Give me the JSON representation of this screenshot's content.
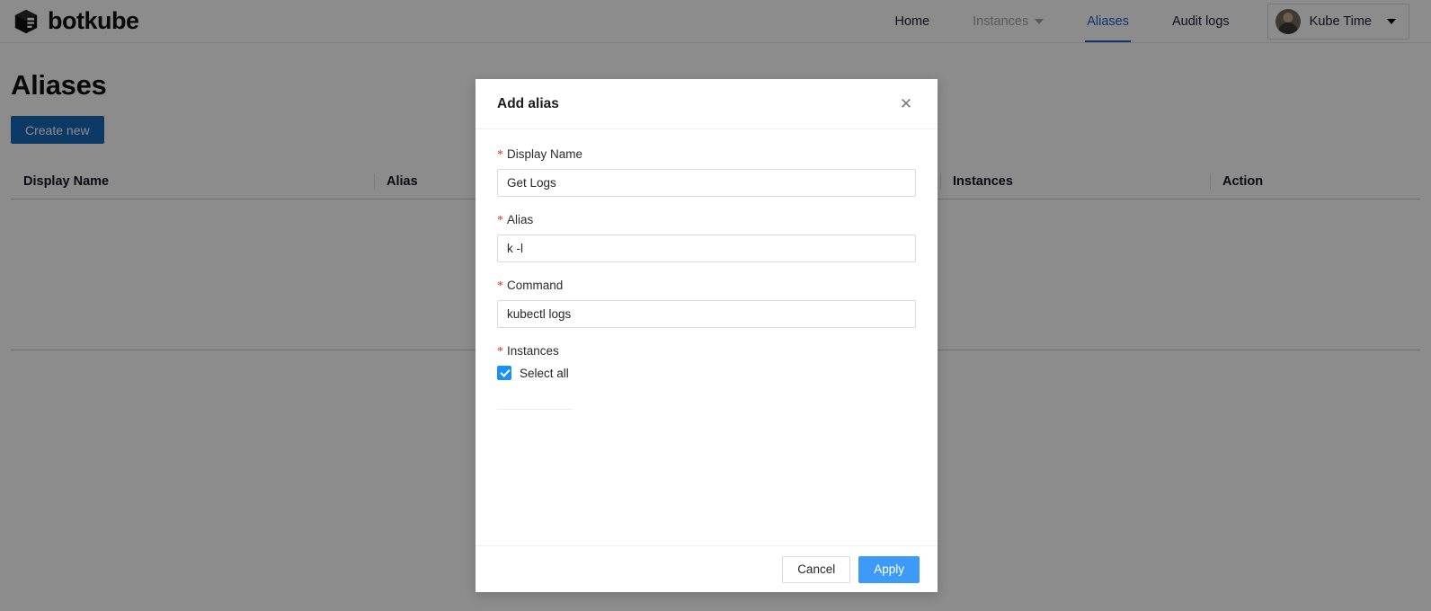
{
  "brand": {
    "name": "botkube",
    "logo_icon": "cube-icon"
  },
  "nav": {
    "items": [
      {
        "label": "Home",
        "state": "default",
        "icon": null
      },
      {
        "label": "Instances",
        "state": "muted",
        "icon": "chevron-down-icon"
      },
      {
        "label": "Aliases",
        "state": "active",
        "icon": null
      },
      {
        "label": "Audit logs",
        "state": "default",
        "icon": null
      }
    ],
    "user": {
      "name": "Kube Time",
      "avatar_icon": "avatar",
      "caret_icon": "chevron-down-icon"
    },
    "active_color": "#1c5fd0"
  },
  "page": {
    "title": "Aliases",
    "create_button": "Create new",
    "create_button_color": "#1669bb"
  },
  "table": {
    "columns": [
      "Display Name",
      "Alias",
      "Instances",
      "Action"
    ],
    "rows": []
  },
  "modal": {
    "title": "Add alias",
    "close_icon": "close-icon",
    "required_mark": "*",
    "fields": [
      {
        "label": "Display Name",
        "value": "Get Logs",
        "placeholder": ""
      },
      {
        "label": "Alias",
        "value": "k -l",
        "placeholder": ""
      },
      {
        "label": "Command",
        "value": "kubectl logs",
        "placeholder": ""
      }
    ],
    "instances": {
      "label": "Instances",
      "select_all_label": "Select all",
      "select_all_checked": true,
      "checkbox_color": "#1890ff"
    },
    "footer": {
      "cancel_label": "Cancel",
      "apply_label": "Apply",
      "apply_color": "#3d9bf7"
    }
  }
}
